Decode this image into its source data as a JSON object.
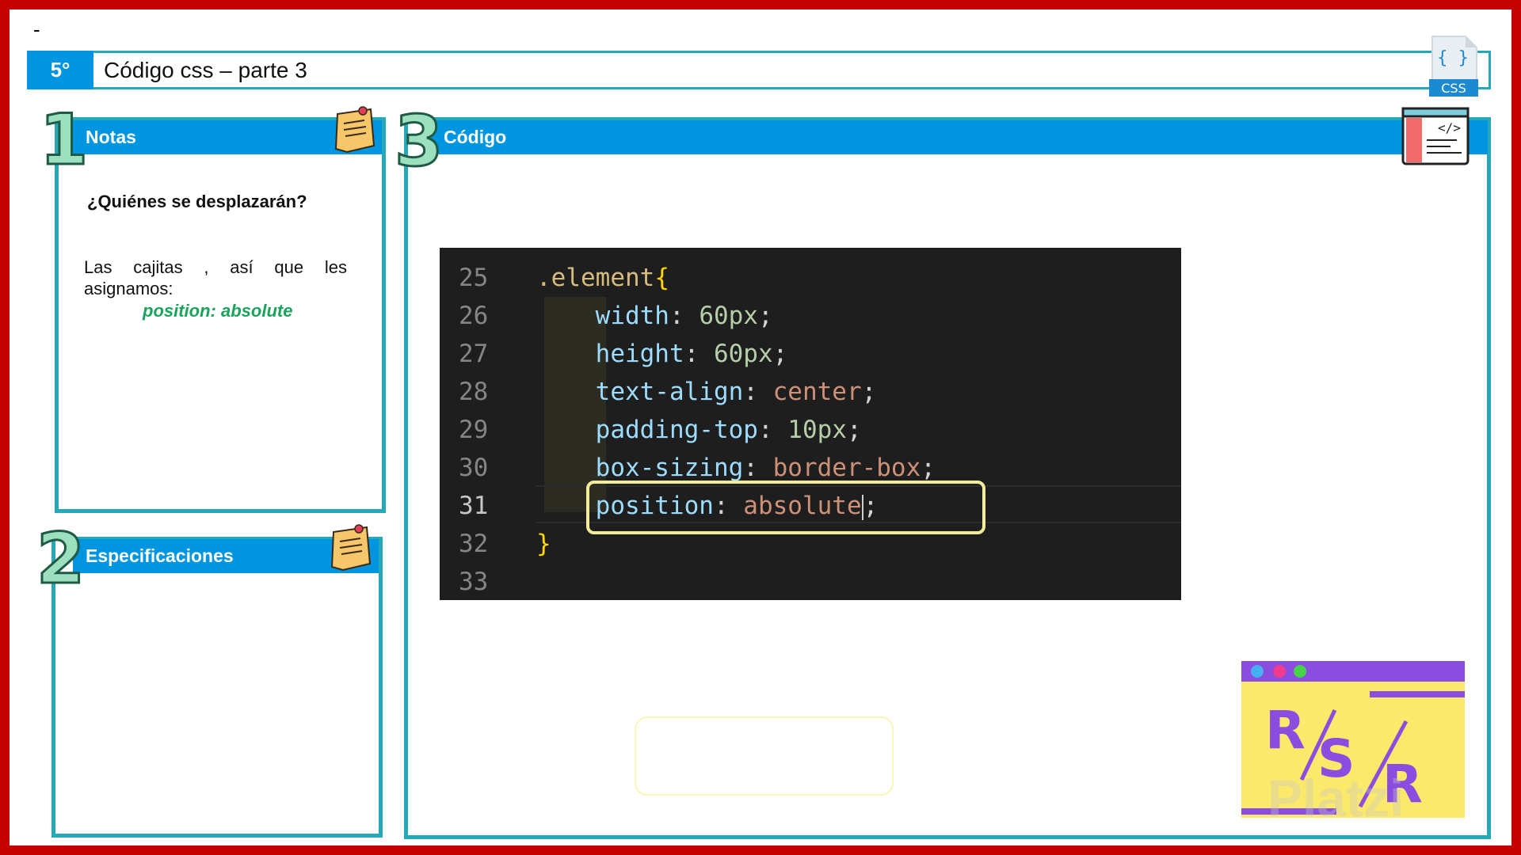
{
  "top_mark": "-",
  "header": {
    "number": "5°",
    "title": "Código css – parte 3",
    "icon": "css-file-icon",
    "icon_text": "CSS",
    "icon_glyph": "{ }"
  },
  "panels": {
    "notes": {
      "number": "1",
      "title": "Notas",
      "question": "¿Quiénes se desplazarán?",
      "body_line1": "Las cajitas , así que les",
      "body_line2": "asignamos:",
      "code": "position: absolute"
    },
    "specs": {
      "number": "2",
      "title": "Especificaciones"
    },
    "code": {
      "number": "3",
      "title": "Código"
    }
  },
  "editor": {
    "lines": [
      {
        "n": "25",
        "selector": ".element",
        "brace": "{"
      },
      {
        "n": "26",
        "prop": "width",
        "value": "60px"
      },
      {
        "n": "27",
        "prop": "height",
        "value": "60px"
      },
      {
        "n": "28",
        "prop": "text-align",
        "value": "center"
      },
      {
        "n": "29",
        "prop": "padding-top",
        "value": "10px"
      },
      {
        "n": "30",
        "prop": "box-sizing",
        "value": "border-box"
      },
      {
        "n": "31",
        "prop": "position",
        "value": "absolute",
        "active": true
      },
      {
        "n": "32",
        "brace": "}"
      },
      {
        "n": "33"
      }
    ]
  },
  "logo": {
    "letters": [
      "R",
      "S",
      "R"
    ],
    "watermark": "Platzi"
  },
  "colors": {
    "frame": "#c40000",
    "accent": "#0095e0",
    "border": "#26a9b6",
    "code_green": "#1aa35a"
  }
}
